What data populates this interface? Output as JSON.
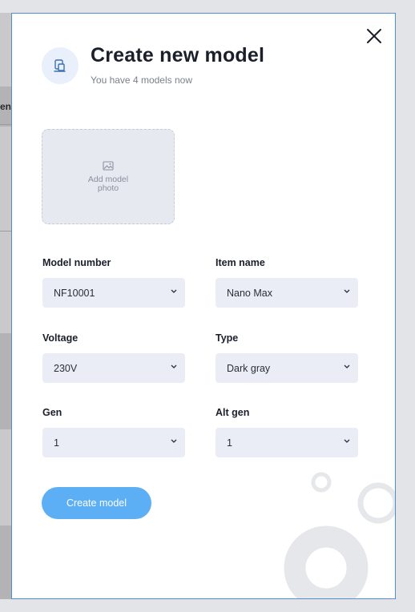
{
  "background": {
    "partial_label": "en"
  },
  "modal": {
    "title": "Create new model",
    "subtitle": "You have 4 models now",
    "header_icon": "device-icon",
    "close_icon": "close-icon",
    "photo": {
      "label": "Add model photo",
      "icon": "image-icon"
    },
    "fields": {
      "model_number": {
        "label": "Model number",
        "value": "NF10001"
      },
      "item_name": {
        "label": "Item name",
        "value": "Nano Max"
      },
      "voltage": {
        "label": "Voltage",
        "value": "230V"
      },
      "type": {
        "label": "Type",
        "value": "Dark gray"
      },
      "gen": {
        "label": "Gen",
        "value": "1"
      },
      "alt_gen": {
        "label": "Alt gen",
        "value": "1"
      }
    },
    "submit_label": "Create model"
  },
  "colors": {
    "accent": "#5daff5",
    "modal_border": "#4f8fd6",
    "field_bg": "#eaedf5",
    "title": "#1b1f2a",
    "decoration": "#e6e7ea"
  }
}
